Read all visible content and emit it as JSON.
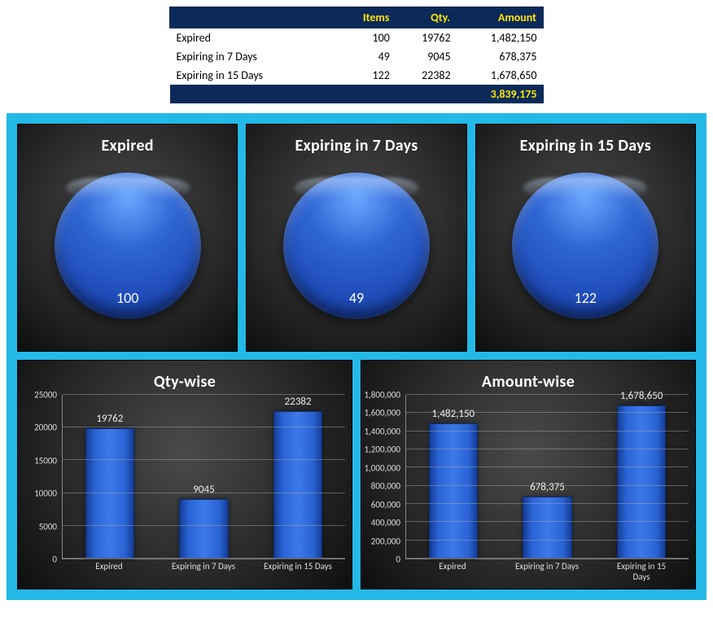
{
  "table": {
    "headers": [
      "",
      "Items",
      "Qty.",
      "Amount"
    ],
    "rows": [
      {
        "label": "Expired",
        "items": "100",
        "qty": "19762",
        "amount": "1,482,150"
      },
      {
        "label": "Expiring in 7 Days",
        "items": "49",
        "qty": "9045",
        "amount": "678,375"
      },
      {
        "label": "Expiring in 15 Days",
        "items": "122",
        "qty": "22382",
        "amount": "1,678,650"
      }
    ],
    "total_amount": "3,839,175"
  },
  "pies": [
    {
      "title": "Expired",
      "value": "100"
    },
    {
      "title": "Expiring  in 7 Days",
      "value": "49"
    },
    {
      "title": "Expiring  in 15 Days",
      "value": "122"
    }
  ],
  "bar_qty": {
    "title": "Qty-wise",
    "ticks": [
      "0",
      "5000",
      "10000",
      "15000",
      "20000",
      "25000"
    ],
    "max": 25000,
    "bars": [
      {
        "label": "Expired",
        "value": 19762,
        "text": "19762"
      },
      {
        "label": "Expiring in 7 Days",
        "value": 9045,
        "text": "9045"
      },
      {
        "label": "Expiring in 15 Days",
        "value": 22382,
        "text": "22382"
      }
    ]
  },
  "bar_amt": {
    "title": "Amount-wise",
    "ticks": [
      "0",
      "200,000",
      "400,000",
      "600,000",
      "800,000",
      "1,000,000",
      "1,200,000",
      "1,400,000",
      "1,600,000",
      "1,800,000"
    ],
    "max": 1800000,
    "bars": [
      {
        "label": "Expired",
        "value": 1482150,
        "text": "1,482,150"
      },
      {
        "label": "Expiring in 7 Days",
        "value": 678375,
        "text": "678,375"
      },
      {
        "label": "Expiring in 15\nDays",
        "value": 1678650,
        "text": "1,678,650"
      }
    ]
  },
  "chart_data": [
    {
      "type": "pie",
      "title": "Expired",
      "categories": [
        "Expired"
      ],
      "values": [
        100
      ]
    },
    {
      "type": "pie",
      "title": "Expiring in 7 Days",
      "categories": [
        "Expiring in 7 Days"
      ],
      "values": [
        49
      ]
    },
    {
      "type": "pie",
      "title": "Expiring in 15 Days",
      "categories": [
        "Expiring in 15 Days"
      ],
      "values": [
        122
      ]
    },
    {
      "type": "bar",
      "title": "Qty-wise",
      "categories": [
        "Expired",
        "Expiring in 7 Days",
        "Expiring in 15 Days"
      ],
      "values": [
        19762,
        9045,
        22382
      ],
      "xlabel": "",
      "ylabel": "",
      "ylim": [
        0,
        25000
      ]
    },
    {
      "type": "bar",
      "title": "Amount-wise",
      "categories": [
        "Expired",
        "Expiring in 7 Days",
        "Expiring in 15 Days"
      ],
      "values": [
        1482150,
        678375,
        1678650
      ],
      "xlabel": "",
      "ylabel": "",
      "ylim": [
        0,
        1800000
      ]
    },
    {
      "type": "table",
      "title": "",
      "columns": [
        "",
        "Items",
        "Qty.",
        "Amount"
      ],
      "rows": [
        [
          "Expired",
          100,
          19762,
          1482150
        ],
        [
          "Expiring in 7 Days",
          49,
          9045,
          678375
        ],
        [
          "Expiring in 15 Days",
          122,
          22382,
          1678650
        ]
      ],
      "total": 3839175
    }
  ]
}
